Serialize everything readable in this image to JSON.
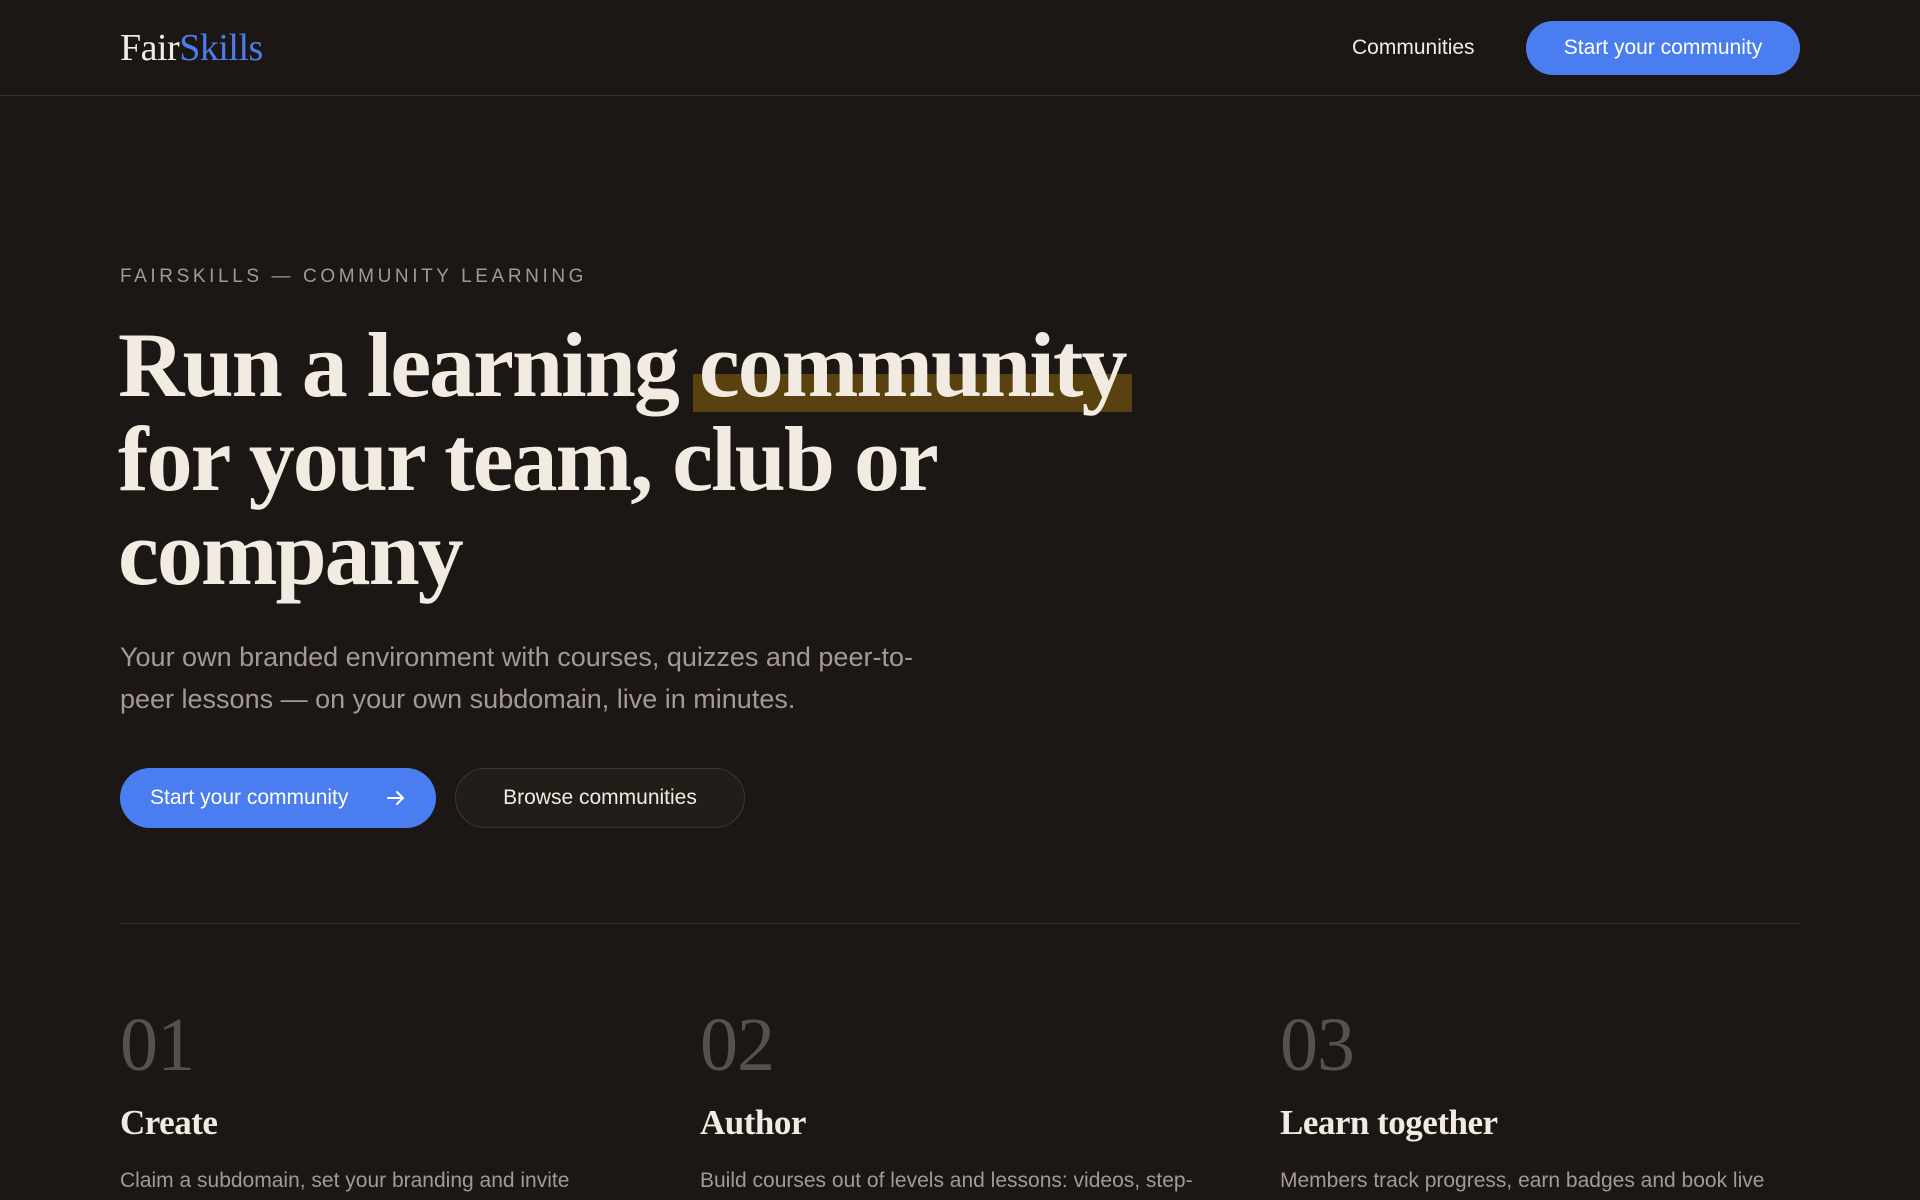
{
  "header": {
    "logo_part1": "Fair",
    "logo_part2": "Skills",
    "nav_communities": "Communities",
    "cta": "Start your community"
  },
  "hero": {
    "eyebrow": "FAIRSKILLS — COMMUNITY LEARNING",
    "headline_line1_a": "Run a learning ",
    "headline_line1_highlight": "community",
    "headline_line2": "for your team, club or",
    "headline_line3": "company",
    "subhead": "Your own branded environment with courses, quizzes and peer-to-peer lessons — on your own subdomain, live in minutes.",
    "primary_button": "Start your community",
    "secondary_button": "Browse communities"
  },
  "steps": [
    {
      "number": "01",
      "title": "Create",
      "text": "Claim a subdomain, set your branding and invite"
    },
    {
      "number": "02",
      "title": "Author",
      "text": "Build courses out of levels and lessons: videos, step-"
    },
    {
      "number": "03",
      "title": "Learn together",
      "text": "Members track progress, earn badges and book live"
    }
  ],
  "icons": {
    "primary_button_icon": "arrow-right-icon"
  },
  "colors": {
    "background": "#1c1714",
    "accent_blue": "#4a7ef0",
    "highlight": "#5a4210",
    "muted_text": "#a39a90"
  }
}
